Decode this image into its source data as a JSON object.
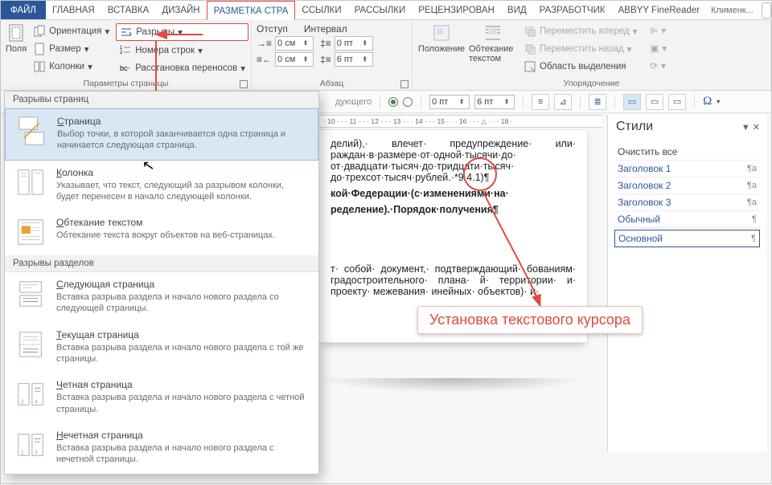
{
  "tabs": {
    "file": "ФАЙЛ",
    "items": [
      "ГЛАВНАЯ",
      "ВСТАВКА",
      "ДИЗАЙН",
      "РАЗМЕТКА СТРА",
      "ССЫЛКИ",
      "РАССЫЛКИ",
      "РЕЦЕНЗИРОВАН",
      "ВИД",
      "РАЗРАБОТЧИК",
      "ABBYY FineReader"
    ],
    "active_index": 3,
    "user": "Клименк..."
  },
  "ribbon": {
    "page_params": {
      "fields": "Поля",
      "orientation": "Ориентация",
      "size": "Размер",
      "columns": "Колонки",
      "breaks": "Разрывы",
      "line_numbers": "Номера строк",
      "hyphenation": "Расстановка переносов",
      "label": "Параметры страницы"
    },
    "paragraph": {
      "indent_label": "Отступ",
      "spacing_label": "Интервал",
      "left": "0 см",
      "right": "0 см",
      "before": "0 пт",
      "after": "6 пт",
      "label": "Абзац"
    },
    "arrange": {
      "position": "Положение",
      "wrap": "Обтекание текстом",
      "forward": "Переместить вперед",
      "back": "Переместить назад",
      "selection": "Область выделения",
      "label": "Упорядочение"
    }
  },
  "toolbar2": {
    "before": "0 пт",
    "after": "6 пт",
    "ruler": "· 10 · · · 11 · · · 12 · · · 13 · · · 14 · · · 15 · · · 16 · · · △ · · · 18 ·"
  },
  "panel": {
    "hdr1": "Разрывы страниц",
    "hdr2": "Разрывы разделов",
    "items_page": [
      {
        "title": "Страница",
        "mn": "С",
        "desc": "Выбор точки, в которой заканчивается одна страница и начинается следующая страница."
      },
      {
        "title": "Колонка",
        "mn": "К",
        "desc": "Указывает, что текст, следующий за разрывом колонки, будет перенесен в начало следующей колонки."
      },
      {
        "title": "Обтекание текстом",
        "mn": "О",
        "desc": "Обтекание текста вокруг объектов на веб-страницах."
      }
    ],
    "items_section": [
      {
        "title": "Следующая страница",
        "mn": "С",
        "desc": "Вставка разрыва раздела и начало нового раздела со следующей страницы."
      },
      {
        "title": "Текущая страница",
        "mn": "Т",
        "desc": "Вставка разрыва раздела и начало нового раздела с той же страницы."
      },
      {
        "title": "Четная страница",
        "mn": "Ч",
        "desc": "Вставка разрыва раздела и начало нового раздела с четной страницы."
      },
      {
        "title": "Нечетная страница",
        "mn": "Н",
        "desc": "Вставка разрыва раздела и начало нового раздела с нечетной страницы."
      }
    ]
  },
  "document": {
    "p1": "делий),· влечет· предупреждение· или· раждан·в·размере·от·одной·тысячи·до· от·двадцати·тысяч·до·тридцати·тысяч· до·трехсот·тысяч·рублей.·*9.4.1)¶",
    "p2": "кой·Федерации·(с·изменениями·на·",
    "p3": "ределение).·Порядок·получения¶",
    "p4": "т· собой· документ,· подтверждающий· бованиям· градостроительного· плана· й· территории· и· проекту· межевания· инейных· объектов)· и·"
  },
  "callout": "Установка текстового курсора",
  "styles": {
    "title": "Стили",
    "clear": "Очистить все",
    "items": [
      {
        "name": "Заголовок 1",
        "mark": "¶a"
      },
      {
        "name": "Заголовок 2",
        "mark": "¶a"
      },
      {
        "name": "Заголовок 3",
        "mark": "¶a"
      },
      {
        "name": "Обычный",
        "mark": "¶"
      },
      {
        "name": "Основной",
        "mark": "¶"
      }
    ],
    "selected_index": 4
  }
}
